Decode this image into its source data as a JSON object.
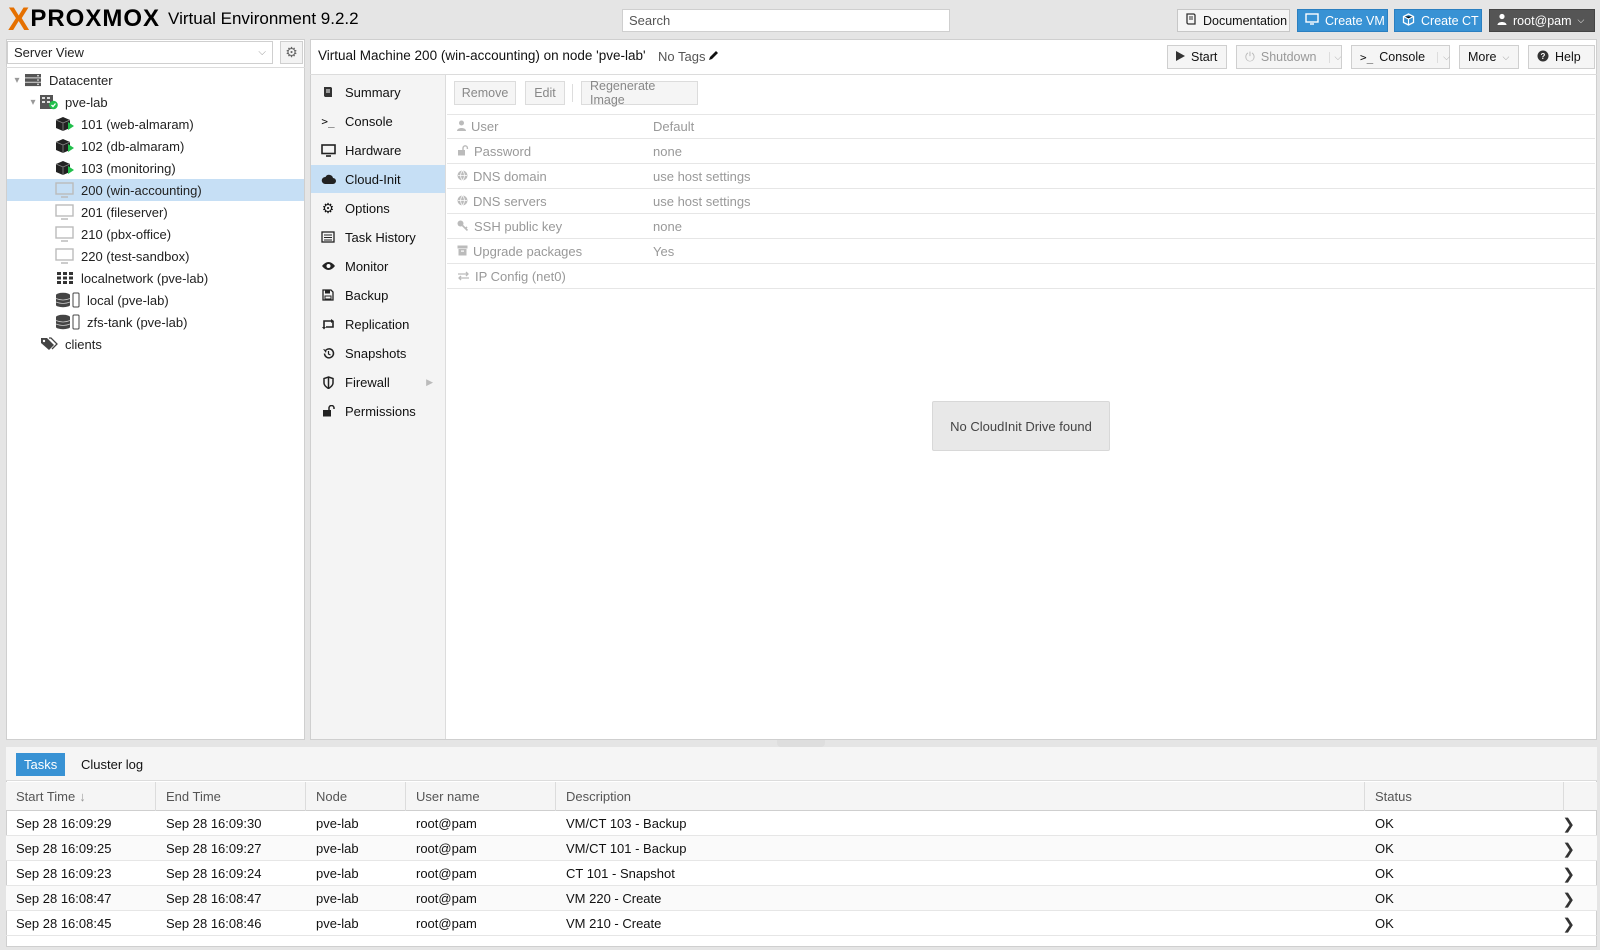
{
  "header": {
    "brand_x": "X",
    "brand_word": "PROXMOX",
    "product": "Virtual Environment 9.2.2",
    "search_placeholder": "Search",
    "documentation": "Documentation",
    "create_vm": "Create VM",
    "create_ct": "Create CT",
    "user": "root@pam",
    "accent": "#e57000",
    "blue": "#3892d4"
  },
  "sidebar": {
    "view": "Server View",
    "tree": [
      {
        "label": "Datacenter",
        "icon": "datacenter-icon"
      },
      {
        "label": "pve-lab",
        "icon": "node-online-icon"
      },
      {
        "label": "101 (web-almaram)",
        "icon": "container-running-icon"
      },
      {
        "label": "102 (db-almaram)",
        "icon": "container-running-icon"
      },
      {
        "label": "103 (monitoring)",
        "icon": "container-running-icon"
      },
      {
        "label": "200 (win-accounting)",
        "icon": "vm-stopped-icon"
      },
      {
        "label": "201 (fileserver)",
        "icon": "vm-stopped-icon"
      },
      {
        "label": "210 (pbx-office)",
        "icon": "vm-stopped-icon"
      },
      {
        "label": "220 (test-sandbox)",
        "icon": "vm-stopped-icon"
      },
      {
        "label": "localnetwork (pve-lab)",
        "icon": "network-grid-icon"
      },
      {
        "label": "local (pve-lab)",
        "icon": "storage-icon"
      },
      {
        "label": "zfs-tank (pve-lab)",
        "icon": "storage-icon"
      },
      {
        "label": "clients",
        "icon": "tags-icon"
      }
    ]
  },
  "vm": {
    "title": "Virtual Machine 200 (win-accounting) on node 'pve-lab'",
    "tags": "No Tags",
    "start": "Start",
    "shutdown": "Shutdown",
    "console": "Console",
    "more": "More",
    "help": "Help"
  },
  "nav": [
    {
      "label": "Summary",
      "icon": "book-icon"
    },
    {
      "label": "Console",
      "icon": "terminal-icon"
    },
    {
      "label": "Hardware",
      "icon": "monitor-icon"
    },
    {
      "label": "Cloud-Init",
      "icon": "cloud-icon"
    },
    {
      "label": "Options",
      "icon": "gear-icon"
    },
    {
      "label": "Task History",
      "icon": "list-icon"
    },
    {
      "label": "Monitor",
      "icon": "eye-icon"
    },
    {
      "label": "Backup",
      "icon": "floppy-icon"
    },
    {
      "label": "Replication",
      "icon": "retweet-icon"
    },
    {
      "label": "Snapshots",
      "icon": "history-icon"
    },
    {
      "label": "Firewall",
      "icon": "shield-icon"
    },
    {
      "label": "Permissions",
      "icon": "unlock-icon"
    }
  ],
  "cloudinit": {
    "remove": "Remove",
    "edit": "Edit",
    "regenerate": "Regenerate Image",
    "rows": [
      {
        "key": "User",
        "value": "Default",
        "icon": "user-icon"
      },
      {
        "key": "Password",
        "value": "none",
        "icon": "unlock-icon"
      },
      {
        "key": "DNS domain",
        "value": "use host settings",
        "icon": "globe-icon"
      },
      {
        "key": "DNS servers",
        "value": "use host settings",
        "icon": "globe-icon"
      },
      {
        "key": "SSH public key",
        "value": "none",
        "icon": "key-icon"
      },
      {
        "key": "Upgrade packages",
        "value": "Yes",
        "icon": "archive-icon"
      },
      {
        "key": "IP Config (net0)",
        "value": "",
        "icon": "exchange-icon"
      }
    ],
    "empty_message": "No CloudInit Drive found"
  },
  "bottom": {
    "tabs": [
      "Tasks",
      "Cluster log"
    ],
    "columns": [
      "Start Time",
      "End Time",
      "Node",
      "User name",
      "Description",
      "Status"
    ],
    "rows": [
      [
        "Sep 28 16:09:29",
        "Sep 28 16:09:30",
        "pve-lab",
        "root@pam",
        "VM/CT 103 - Backup",
        "OK"
      ],
      [
        "Sep 28 16:09:25",
        "Sep 28 16:09:27",
        "pve-lab",
        "root@pam",
        "VM/CT 101 - Backup",
        "OK"
      ],
      [
        "Sep 28 16:09:23",
        "Sep 28 16:09:24",
        "pve-lab",
        "root@pam",
        "CT 101 - Snapshot",
        "OK"
      ],
      [
        "Sep 28 16:08:47",
        "Sep 28 16:08:47",
        "pve-lab",
        "root@pam",
        "VM 220 - Create",
        "OK"
      ],
      [
        "Sep 28 16:08:45",
        "Sep 28 16:08:46",
        "pve-lab",
        "root@pam",
        "VM 210 - Create",
        "OK"
      ]
    ]
  }
}
